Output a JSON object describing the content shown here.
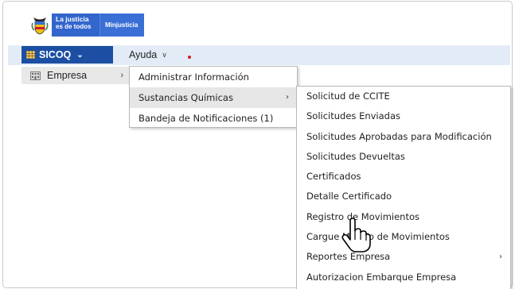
{
  "brand": {
    "crest_icon": "colombia-crest-icon",
    "line1": "La justicia",
    "line2": "es de todos",
    "ministry": "Minjusticia"
  },
  "menubar": {
    "app_label": "SICOQ",
    "help_label": "Ayuda",
    "accent": "#1c4fa3",
    "bar_color": "#e3ecf6"
  },
  "side_menu": {
    "empresa_label": "Empresa"
  },
  "submenu1": {
    "items": [
      {
        "label": "Administrar Información"
      },
      {
        "label": "Sustancias Químicas"
      },
      {
        "label": "Bandeja de Notificaciones (1)"
      }
    ]
  },
  "submenu2": {
    "items": [
      {
        "label": "Solicitud de CCITE"
      },
      {
        "label": "Solicitudes Enviadas"
      },
      {
        "label": "Solicitudes Aprobadas para Modificación"
      },
      {
        "label": "Solicitudes Devueltas"
      },
      {
        "label": "Certificados"
      },
      {
        "label": "Detalle Certificado"
      },
      {
        "label": "Registro de Movimientos"
      },
      {
        "label": "Cargue Masivo de Movimientos"
      },
      {
        "label": "Reportes Empresa"
      },
      {
        "label": "Autorizacion Embarque Empresa"
      }
    ]
  },
  "cursor": "hand-pointer-icon"
}
